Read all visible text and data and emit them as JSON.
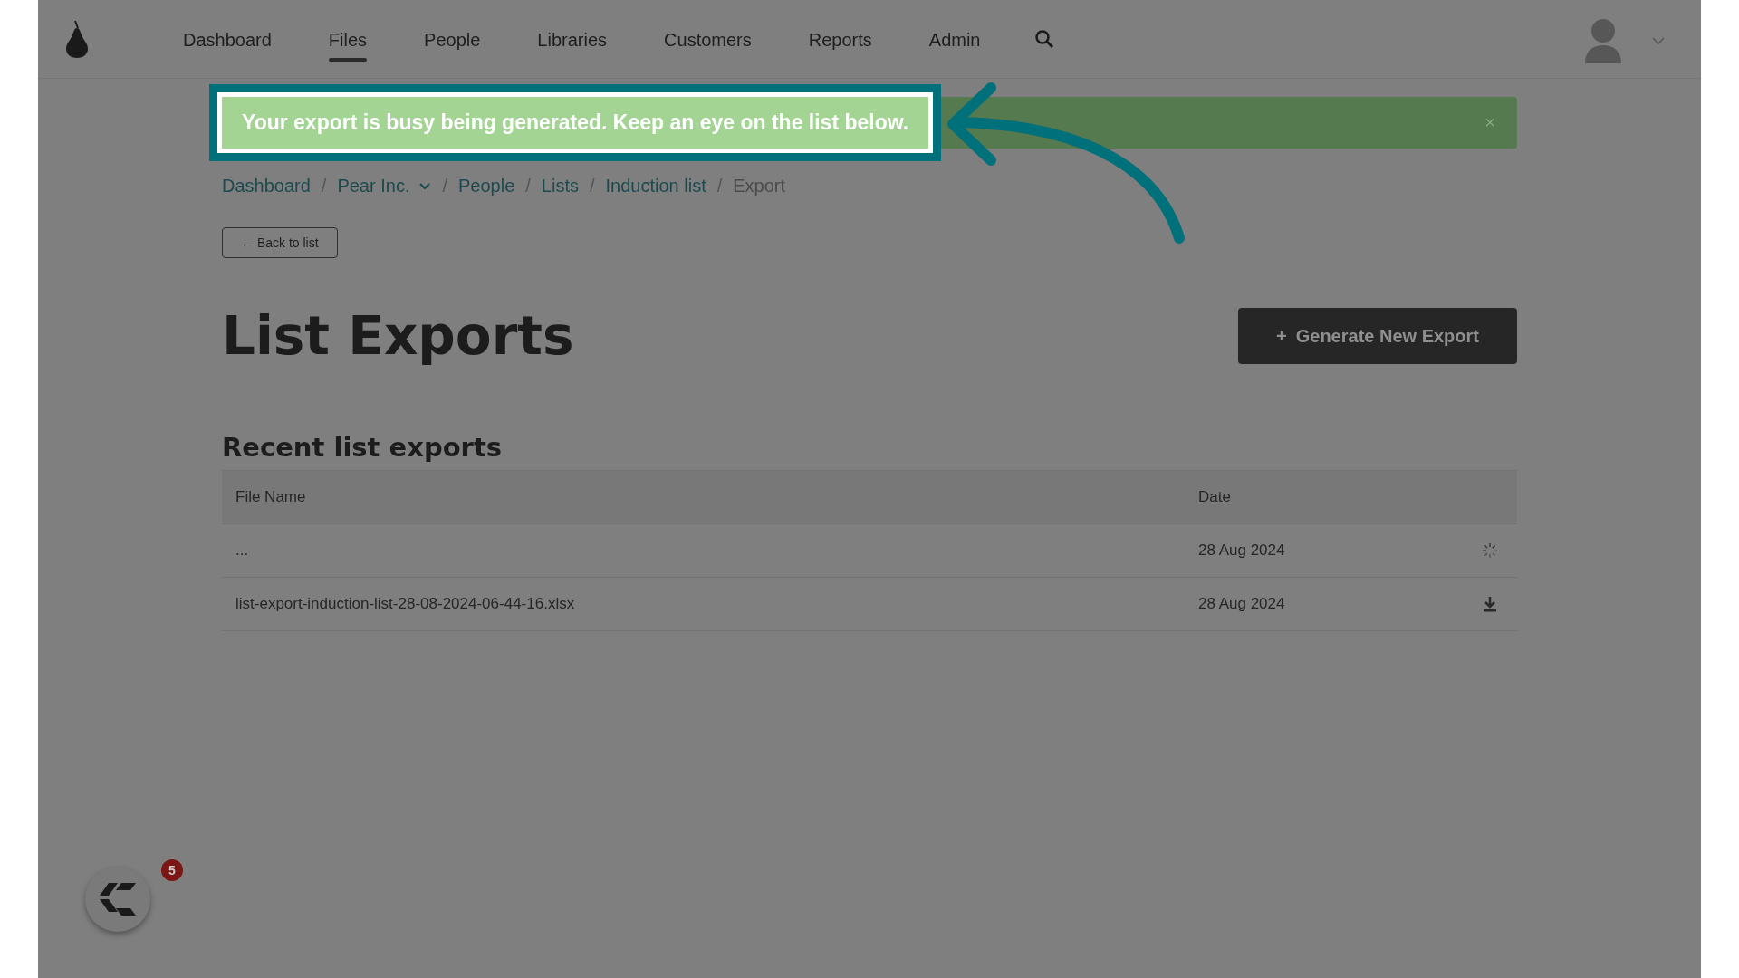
{
  "nav": {
    "items": [
      {
        "label": "Dashboard",
        "selected": false
      },
      {
        "label": "Files",
        "selected": true
      },
      {
        "label": "People",
        "selected": false
      },
      {
        "label": "Libraries",
        "selected": false
      },
      {
        "label": "Customers",
        "selected": false
      },
      {
        "label": "Reports",
        "selected": false
      },
      {
        "label": "Admin",
        "selected": false
      }
    ]
  },
  "alert": {
    "message": "Your export is busy being generated. Keep an eye on the list below.",
    "close": "×"
  },
  "breadcrumb_separator": "/",
  "breadcrumbs": [
    {
      "label": "Dashboard",
      "kind": "link"
    },
    {
      "label": "Pear Inc.",
      "kind": "dropdown"
    },
    {
      "label": "People",
      "kind": "link"
    },
    {
      "label": "Lists",
      "kind": "link"
    },
    {
      "label": "Induction list",
      "kind": "link"
    },
    {
      "label": "Export",
      "kind": "current"
    }
  ],
  "back_button": "← Back to list",
  "title": "List Exports",
  "generate_button": {
    "icon": "+",
    "label": "Generate New Export"
  },
  "section_title": "Recent list exports",
  "table": {
    "columns": [
      "File Name",
      "Date"
    ],
    "rows": [
      {
        "file": "...",
        "date": "28 Aug 2024",
        "kind": "loading"
      },
      {
        "file": "list-export-induction-list-28-08-2024-06-44-16.xlsx",
        "date": "28 Aug 2024",
        "kind": "ready"
      }
    ]
  },
  "chat_widget": {
    "badge": "5"
  }
}
